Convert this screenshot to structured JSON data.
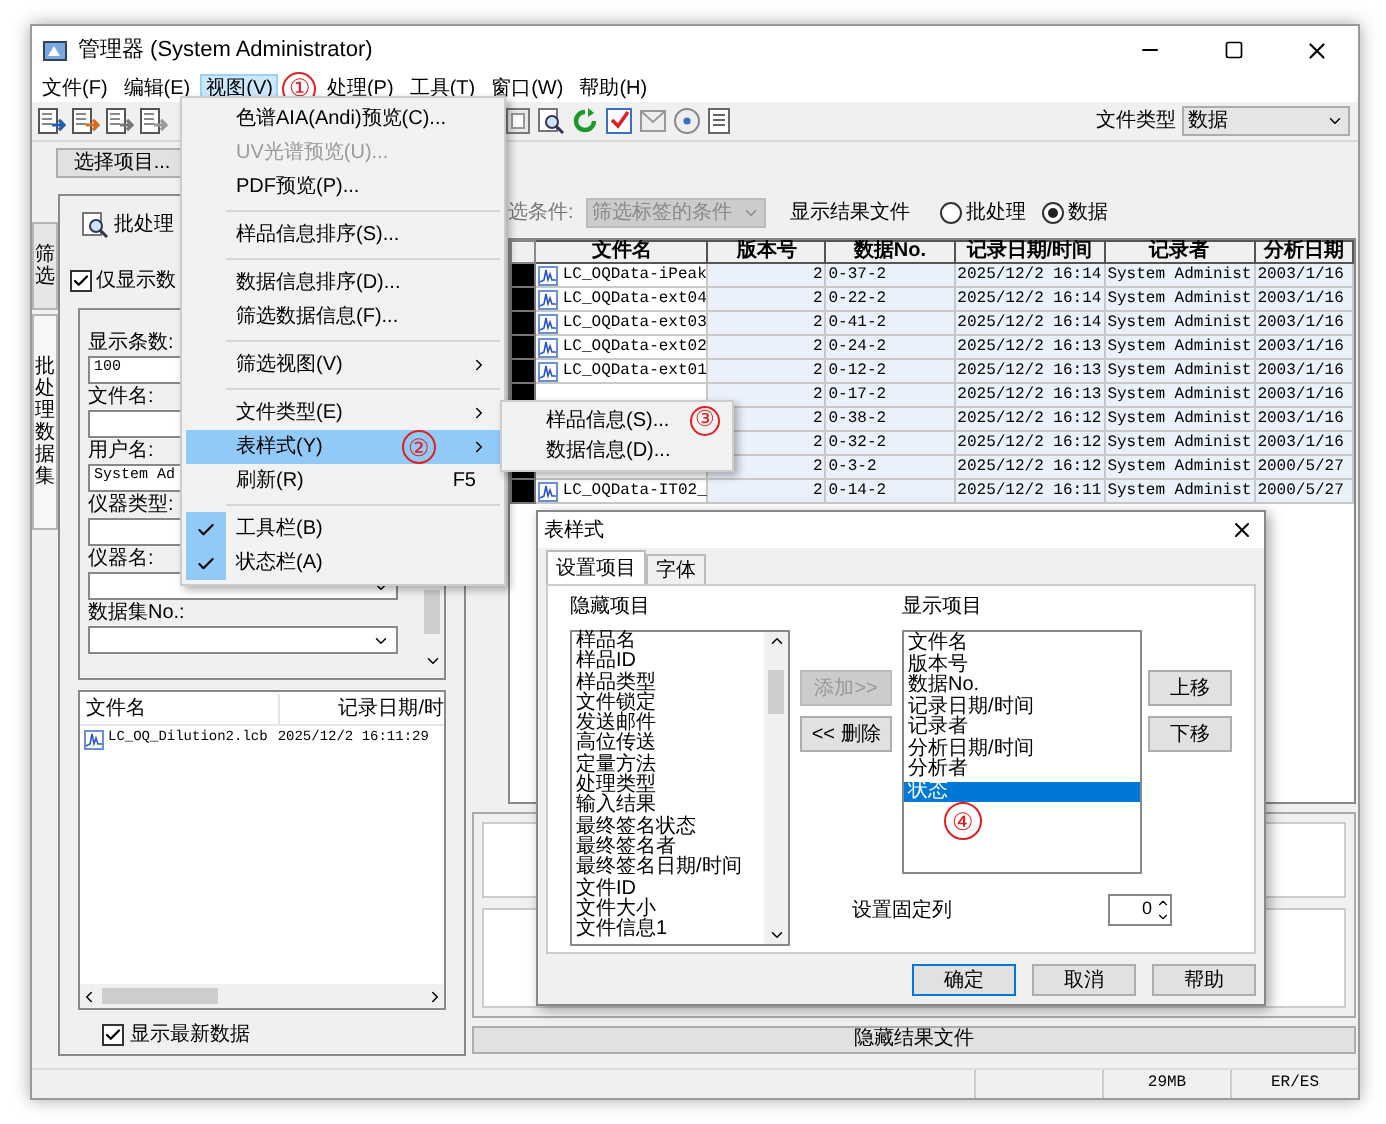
{
  "window": {
    "title": "管理器 (System Administrator)"
  },
  "menu_bar": [
    {
      "label": "文件(F)",
      "selected": false
    },
    {
      "label": "编辑(E)",
      "selected": false
    },
    {
      "label": "视图(V)",
      "selected": true
    },
    {
      "label": "处理(P)",
      "selected": false
    },
    {
      "label": "工具(T)",
      "selected": false
    },
    {
      "label": "窗口(W)",
      "selected": false
    },
    {
      "label": "帮助(H)",
      "selected": false
    }
  ],
  "toolbar": {
    "file_type_label": "文件类型",
    "file_type_value": "数据"
  },
  "left_panel": {
    "select_button": "选择项目...",
    "side_tabs": [
      {
        "label": "筛选",
        "selected": false
      },
      {
        "label": "批处理数据集",
        "selected": true
      }
    ],
    "header": "批处理",
    "only_show_checkbox": {
      "label": "仅显示数",
      "checked": true
    },
    "fields": [
      {
        "label": "显示条数:",
        "value": "100",
        "kind": "text"
      },
      {
        "label": "文件名:",
        "kind": "text"
      },
      {
        "label": "用户名:",
        "value": "System Ad",
        "kind": "text"
      },
      {
        "label": "仪器类型:",
        "kind": "text"
      },
      {
        "label": "仪器名:",
        "kind": "dropdown"
      },
      {
        "label": "数据集No.:",
        "kind": "dropdown"
      }
    ],
    "file_list": {
      "columns": [
        "文件名",
        "记录日期/时"
      ],
      "rows": [
        [
          "LC_OQ_Dilution2.lcb",
          "2025/12/2 16:11:29"
        ]
      ]
    },
    "latest_checkbox": {
      "label": "显示最新数据",
      "checked": true
    }
  },
  "filter": {
    "label": "选条件:",
    "condition": {
      "placeholder": "筛选标签的条件",
      "disabled": true
    },
    "show_result_label": "显示结果文件",
    "radios": [
      {
        "label": "批处理",
        "selected": false
      },
      {
        "label": "数据",
        "selected": true
      }
    ]
  },
  "table": {
    "columns": [
      "文件名",
      "版本号",
      "数据No.",
      "记录日期/时间",
      "记录者",
      "分析日期"
    ],
    "rows": [
      {
        "file_name": "LC_OQData-iPeak",
        "version": "2",
        "data_no": "0-37-2",
        "recorded": "2025/12/2 16:14",
        "recorder": "System Administ",
        "analyzed": "2003/1/16"
      },
      {
        "file_name": "LC_OQData-ext04",
        "version": "2",
        "data_no": "0-22-2",
        "recorded": "2025/12/2 16:14",
        "recorder": "System Administ",
        "analyzed": "2003/1/16"
      },
      {
        "file_name": "LC_OQData-ext03",
        "version": "2",
        "data_no": "0-41-2",
        "recorded": "2025/12/2 16:14",
        "recorder": "System Administ",
        "analyzed": "2003/1/16"
      },
      {
        "file_name": "LC_OQData-ext02",
        "version": "2",
        "data_no": "0-24-2",
        "recorded": "2025/12/2 16:13",
        "recorder": "System Administ",
        "analyzed": "2003/1/16"
      },
      {
        "file_name": "LC_OQData-ext01",
        "version": "2",
        "data_no": "0-12-2",
        "recorded": "2025/12/2 16:13",
        "recorder": "System Administ",
        "analyzed": "2003/1/16"
      },
      {
        "version": "2",
        "data_no": "0-17-2",
        "recorded": "2025/12/2 16:13",
        "recorder": "System Administ",
        "analyzed": "2003/1/16"
      },
      {
        "version": "2",
        "data_no": "0-38-2",
        "recorded": "2025/12/2 16:12",
        "recorder": "System Administ",
        "analyzed": "2003/1/16"
      },
      {
        "version": "2",
        "data_no": "0-32-2",
        "recorded": "2025/12/2 16:12",
        "recorder": "System Administ",
        "analyzed": "2003/1/16"
      },
      {
        "version": "2",
        "data_no": "0-3-2",
        "recorded": "2025/12/2 16:12",
        "recorder": "System Administ",
        "analyzed": "2000/5/27"
      },
      {
        "file_name": "LC_OQData-IT02_",
        "version": "2",
        "data_no": "0-14-2",
        "recorded": "2025/12/2 16:11",
        "recorder": "System Administ",
        "analyzed": "2000/5/27"
      }
    ]
  },
  "hide_result_button": "隐藏结果文件",
  "status_bar": [
    "29MB",
    "ER/ES"
  ],
  "view_menu": [
    {
      "kind": "item",
      "label": "色谱AIA(Andi)预览(C)...",
      "disabled": false,
      "selected": false,
      "checked": false,
      "submenu": false
    },
    {
      "kind": "item",
      "label": "UV光谱预览(U)...",
      "disabled": true,
      "selected": false,
      "checked": false,
      "submenu": false
    },
    {
      "kind": "item",
      "label": "PDF预览(P)...",
      "disabled": false,
      "selected": false,
      "checked": false,
      "submenu": false
    },
    {
      "kind": "separator"
    },
    {
      "kind": "item",
      "label": "样品信息排序(S)...",
      "disabled": false,
      "selected": false,
      "checked": false,
      "submenu": false
    },
    {
      "kind": "separator"
    },
    {
      "kind": "item",
      "label": "数据信息排序(D)...",
      "disabled": false,
      "selected": false,
      "checked": false,
      "submenu": false
    },
    {
      "kind": "item",
      "label": "筛选数据信息(F)...",
      "disabled": false,
      "selected": false,
      "checked": false,
      "submenu": false
    },
    {
      "kind": "separator"
    },
    {
      "kind": "item",
      "label": "筛选视图(V)",
      "disabled": false,
      "selected": false,
      "checked": false,
      "submenu": true
    },
    {
      "kind": "separator"
    },
    {
      "kind": "item",
      "label": "文件类型(E)",
      "disabled": false,
      "selected": false,
      "checked": false,
      "submenu": true
    },
    {
      "kind": "item",
      "label": "表样式(Y)",
      "disabled": false,
      "selected": true,
      "checked": false,
      "submenu": true
    },
    {
      "kind": "item",
      "label": "刷新(R)",
      "shortcut": "F5",
      "disabled": false,
      "selected": false,
      "checked": false,
      "submenu": false
    },
    {
      "kind": "separator"
    },
    {
      "kind": "item",
      "label": "工具栏(B)",
      "disabled": false,
      "selected": false,
      "checked": true,
      "submenu": false
    },
    {
      "kind": "item",
      "label": "状态栏(A)",
      "disabled": false,
      "selected": false,
      "checked": true,
      "submenu": false
    }
  ],
  "submenu": [
    {
      "label": "样品信息(S)...",
      "selected": false
    },
    {
      "label": "数据信息(D)...",
      "selected": false
    }
  ],
  "dialog": {
    "title": "表样式",
    "tabs": [
      {
        "label": "设置项目",
        "selected": true
      },
      {
        "label": "字体",
        "selected": false
      }
    ],
    "hidden_label": "隐藏项目",
    "hidden_items": [
      "样品名",
      "样品ID",
      "样品类型",
      "文件锁定",
      "发送邮件",
      "高位传送",
      "定量方法",
      "处理类型",
      "输入结果",
      "最终签名状态",
      "最终签名者",
      "最终签名日期/时间",
      "文件ID",
      "文件大小",
      "文件信息1"
    ],
    "add_button": {
      "label": "添加>>",
      "disabled": true
    },
    "remove_button": {
      "label": "<< 删除",
      "disabled": false
    },
    "shown_label": "显示项目",
    "shown_items": [
      {
        "label": "文件名",
        "selected": false
      },
      {
        "label": "版本号",
        "selected": false
      },
      {
        "label": "数据No.",
        "selected": false
      },
      {
        "label": "记录日期/时间",
        "selected": false
      },
      {
        "label": "记录者",
        "selected": false
      },
      {
        "label": "分析日期/时间",
        "selected": false
      },
      {
        "label": "分析者",
        "selected": false
      },
      {
        "label": "状态",
        "selected": true
      }
    ],
    "up_button": "上移",
    "down_button": "下移",
    "fixed_columns_label": "设置固定列",
    "fixed_columns_value": "0",
    "buttons": [
      "确定",
      "取消",
      "帮助"
    ]
  },
  "annotations": [
    "①",
    "②",
    "③",
    "④"
  ]
}
